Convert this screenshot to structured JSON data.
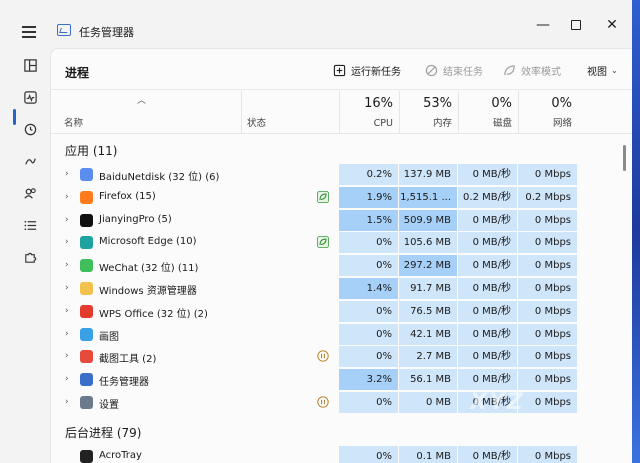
{
  "window": {
    "title": "任务管理器",
    "min_glyph": "—",
    "close_glyph": "✕"
  },
  "toolbar": {
    "page_title": "进程",
    "run_new_task": "运行新任务",
    "end_task": "结束任务",
    "efficiency_mode": "效率模式",
    "view": "视图"
  },
  "columns": {
    "name": "名称",
    "status": "状态",
    "cpu_total": "16%",
    "cpu": "CPU",
    "mem_total": "53%",
    "mem": "内存",
    "disk_total": "0%",
    "disk": "磁盘",
    "net_total": "0%",
    "net": "网络"
  },
  "groups": {
    "apps": "应用 (11)",
    "background": "后台进程 (79)"
  },
  "apps": [
    {
      "name": "BaiduNetdisk (32 位) (6)",
      "status": "",
      "cpu": "0.2%",
      "mem": "137.9 MB",
      "disk": "0 MB/秒",
      "net": "0 Mbps",
      "cpu_heat": "low",
      "mem_heat": "low",
      "icon": "baidu-netdisk-icon",
      "color": "#5b8def"
    },
    {
      "name": "Firefox (15)",
      "status": "efficiency",
      "cpu": "1.9%",
      "mem": "1,515.1 ...",
      "disk": "0.2 MB/秒",
      "net": "0.2 Mbps",
      "cpu_heat": "mid",
      "mem_heat": "mid",
      "icon": "firefox-icon",
      "color": "#ff7a1a"
    },
    {
      "name": "JianyingPro (5)",
      "status": "",
      "cpu": "1.5%",
      "mem": "509.9 MB",
      "disk": "0 MB/秒",
      "net": "0 Mbps",
      "cpu_heat": "mid",
      "mem_heat": "mid",
      "icon": "jianying-icon",
      "color": "#111111"
    },
    {
      "name": "Microsoft Edge (10)",
      "status": "efficiency",
      "cpu": "0%",
      "mem": "105.6 MB",
      "disk": "0 MB/秒",
      "net": "0 Mbps",
      "cpu_heat": "low",
      "mem_heat": "low",
      "icon": "edge-icon",
      "color": "#1fa3a0"
    },
    {
      "name": "WeChat (32 位) (11)",
      "status": "",
      "cpu": "0%",
      "mem": "297.2 MB",
      "disk": "0 MB/秒",
      "net": "0 Mbps",
      "cpu_heat": "low",
      "mem_heat": "mid",
      "icon": "wechat-icon",
      "color": "#3fbf5b"
    },
    {
      "name": "Windows 资源管理器",
      "status": "",
      "cpu": "1.4%",
      "mem": "91.7 MB",
      "disk": "0 MB/秒",
      "net": "0 Mbps",
      "cpu_heat": "mid",
      "mem_heat": "low",
      "icon": "folder-icon",
      "color": "#f2c14e"
    },
    {
      "name": "WPS Office (32 位) (2)",
      "status": "",
      "cpu": "0%",
      "mem": "76.5 MB",
      "disk": "0 MB/秒",
      "net": "0 Mbps",
      "cpu_heat": "low",
      "mem_heat": "low",
      "icon": "wps-icon",
      "color": "#e33b2e"
    },
    {
      "name": "画图",
      "status": "",
      "cpu": "0%",
      "mem": "42.1 MB",
      "disk": "0 MB/秒",
      "net": "0 Mbps",
      "cpu_heat": "low",
      "mem_heat": "low",
      "icon": "paint-icon",
      "color": "#3aa0e6"
    },
    {
      "name": "截图工具 (2)",
      "status": "paused",
      "cpu": "0%",
      "mem": "2.7 MB",
      "disk": "0 MB/秒",
      "net": "0 Mbps",
      "cpu_heat": "low",
      "mem_heat": "low",
      "icon": "snipping-tool-icon",
      "color": "#e64a3c"
    },
    {
      "name": "任务管理器",
      "status": "",
      "cpu": "3.2%",
      "mem": "56.1 MB",
      "disk": "0 MB/秒",
      "net": "0 Mbps",
      "cpu_heat": "mid",
      "mem_heat": "low",
      "icon": "task-manager-icon",
      "color": "#3a6fc9"
    },
    {
      "name": "设置",
      "status": "paused",
      "cpu": "0%",
      "mem": "0 MB",
      "disk": "0 MB/秒",
      "net": "0 Mbps",
      "cpu_heat": "low",
      "mem_heat": "low",
      "icon": "settings-gear-icon",
      "color": "#6b7b8c"
    }
  ],
  "background": [
    {
      "name": "AcroTray",
      "cpu": "0%",
      "mem": "0.1 MB",
      "disk": "0 MB/秒",
      "net": "0 Mbps",
      "icon": "acrotray-icon",
      "color": "#222222"
    }
  ],
  "heat_colors": {
    "low": "#cfe5fa",
    "mid": "#a6d0f7"
  },
  "watermark": "XYZ"
}
